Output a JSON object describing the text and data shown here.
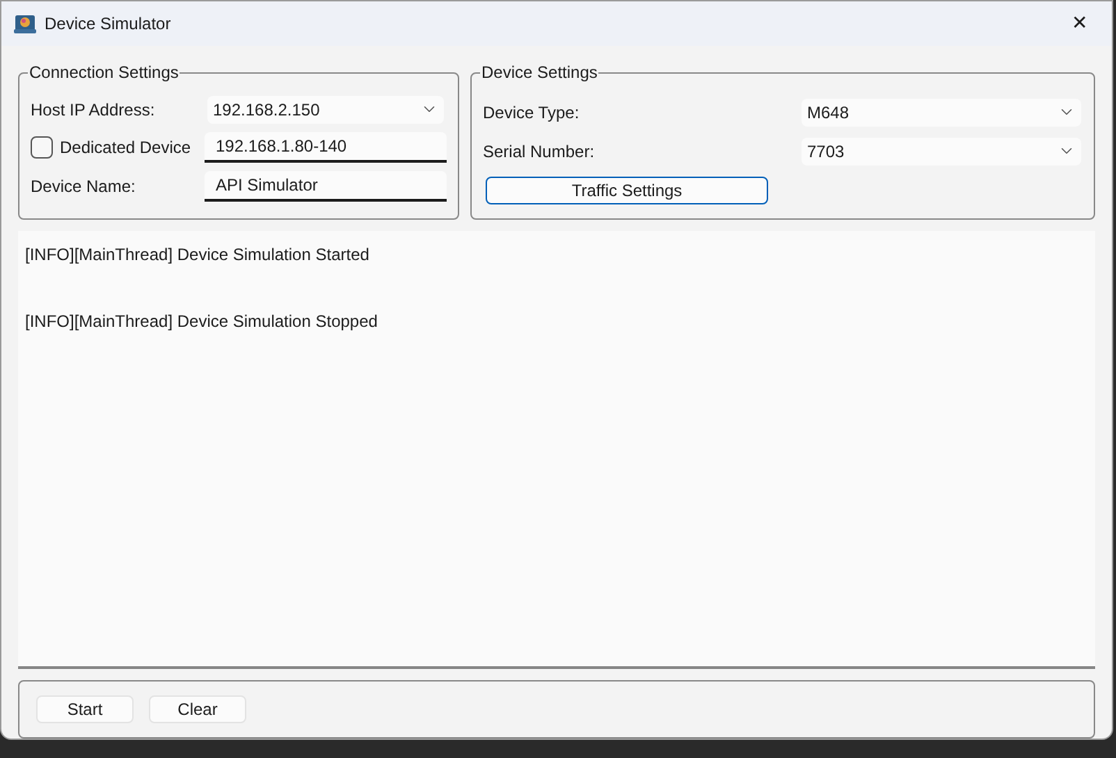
{
  "window": {
    "title": "Device Simulator",
    "close": "✕"
  },
  "connection_settings": {
    "title": "Connection Settings",
    "host_ip": {
      "label": "Host IP Address:",
      "value": "192.168.2.150"
    },
    "dedicated_device": {
      "label": "Dedicated Device",
      "checked": false,
      "value": "192.168.1.80-140"
    },
    "device_name": {
      "label": "Device Name:",
      "value": "API Simulator"
    }
  },
  "device_settings": {
    "title": "Device Settings",
    "device_type": {
      "label": "Device Type:",
      "value": "M648"
    },
    "serial_number": {
      "label": "Serial Number:",
      "value": "7703"
    },
    "traffic_button": "Traffic Settings"
  },
  "log": [
    "[INFO][MainThread] Device Simulation Started",
    "[INFO][MainThread] Device Simulation Stopped"
  ],
  "buttons": [
    "Start",
    "Clear"
  ]
}
